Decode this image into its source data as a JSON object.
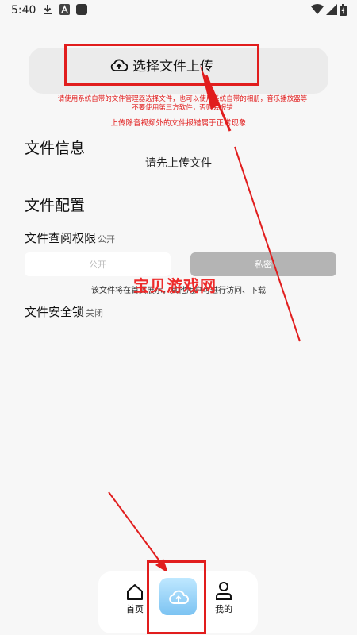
{
  "status": {
    "time": "5:40",
    "icons": [
      "download-icon",
      "app-a-icon",
      "square-app-icon",
      "wifi-icon",
      "signal-icon",
      "battery-icon"
    ]
  },
  "upload": {
    "button_label": "选择文件上传",
    "icon": "cloud-upload-icon",
    "warning_main": "请使用系统自带的文件管理器选择文件，也可以使用系统自带的相册，音乐播放器等不要使用第三方软件，否则会报错",
    "warning_video": "上传除音视频外的文件报错属于正常现象"
  },
  "file_info": {
    "title": "文件信息",
    "placeholder": "请先上传文件"
  },
  "file_config": {
    "title": "文件配置",
    "permission_label": "文件查阅权限",
    "permission_value": "公开",
    "options": [
      "公开",
      "私密"
    ],
    "selected_option": "私密",
    "permission_description": "该文件将在首页展示，其他用户可进行访问、下载",
    "lock_label": "文件安全锁",
    "lock_value": "关闭"
  },
  "watermark": "宝贝游戏网",
  "nav": {
    "home_label": "首页",
    "mine_label": "我的",
    "upload_icon": "cloud-upload-icon"
  },
  "colors": {
    "annotation_red": "#e11d1d",
    "nav_upload_gradient_top": "#bfe8ff",
    "nav_upload_gradient_bottom": "#7cc3f2",
    "private_selected": "#b4b4b4"
  }
}
